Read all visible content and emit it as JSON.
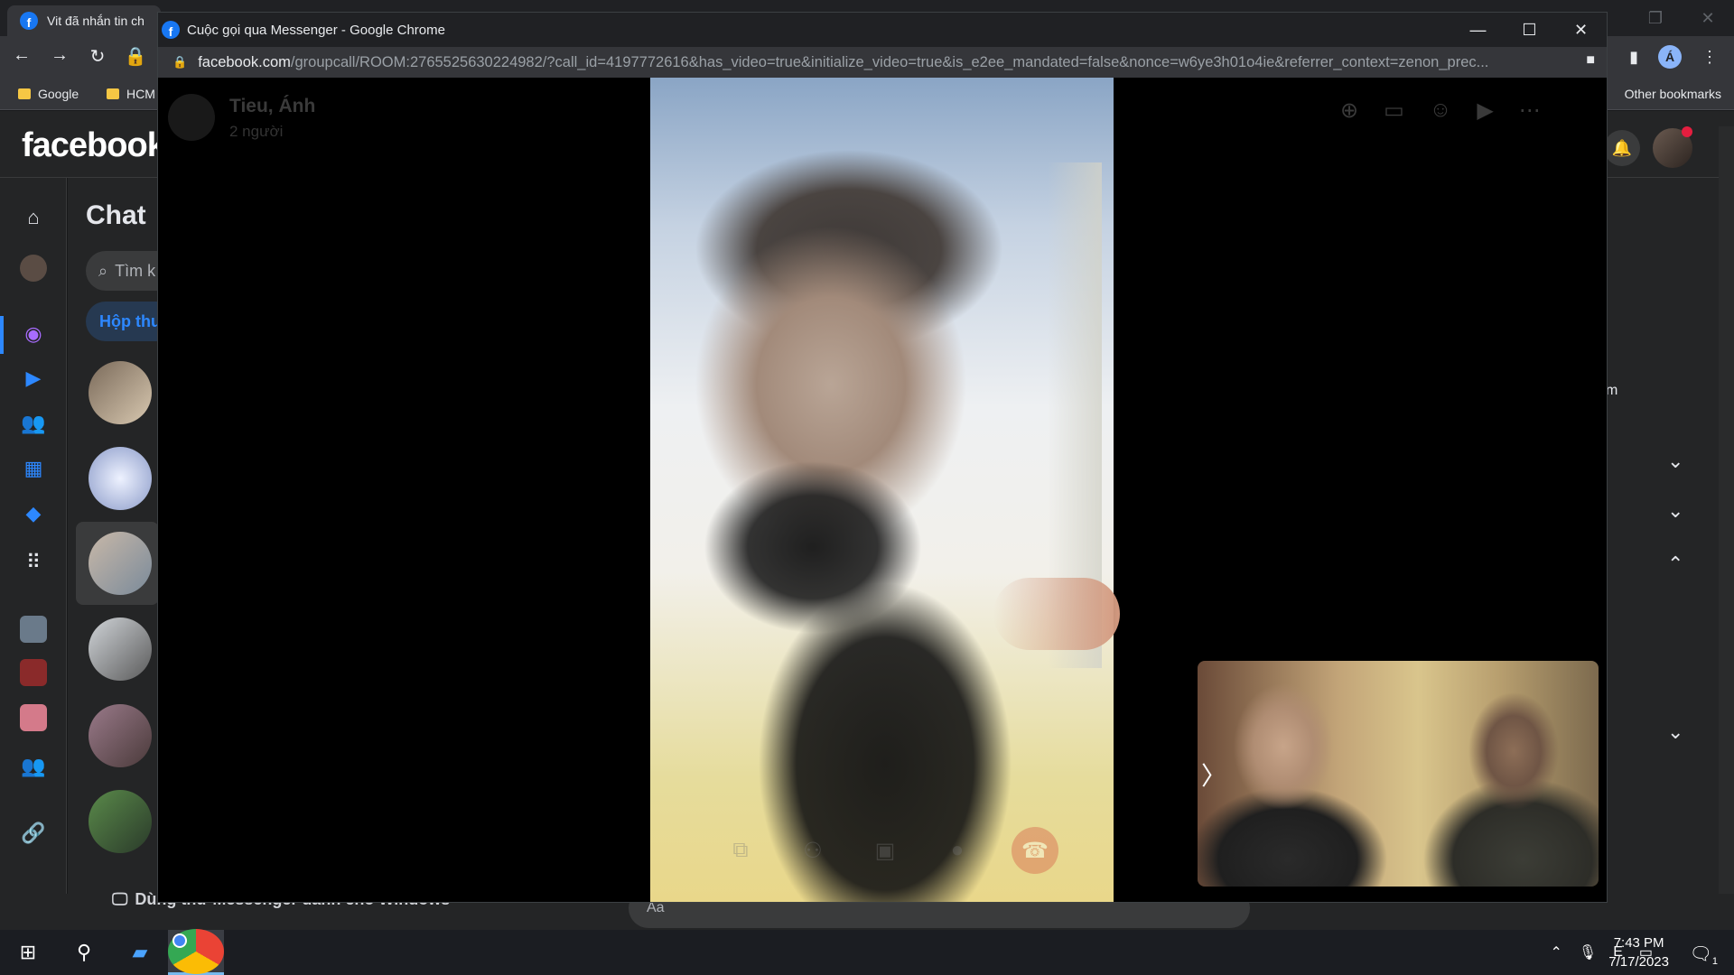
{
  "background_browser": {
    "tab_title": "Vit đã nhắn tin ch",
    "bookmarks": [
      "Google",
      "HCM"
    ],
    "other_bookmarks": "Other bookmarks",
    "profile_initial": "Á"
  },
  "facebook": {
    "logo": "facebook",
    "chat_title": "Chat",
    "search_placeholder": "Tìm k",
    "inbox_tab": "Hộp thư",
    "try_messenger": "Dùng thử Messenger dành cho Windows",
    "message_placeholder": "Aa",
    "right_panel_text": "m"
  },
  "call_window": {
    "title": "Cuộc gọi qua Messenger - Google Chrome",
    "url_host": "facebook.com",
    "url_rest": "/groupcall/ROOM:2765525630224982/?call_id=4197772616&has_video=true&initialize_video=true&is_e2ee_mandated=false&nonce=w6ye3h01o4ie&referrer_context=zenon_prec...",
    "call_name": "Tieu, Ánh",
    "participant_count": "2 người"
  },
  "taskbar": {
    "time": "7:43 PM",
    "date": "7/17/2023",
    "notification_count": "1"
  }
}
